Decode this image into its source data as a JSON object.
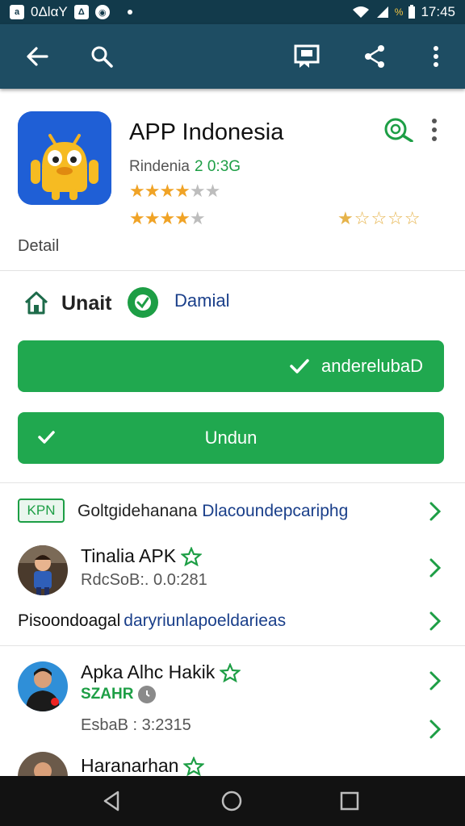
{
  "status_bar": {
    "left_text": "0ΔlαY",
    "time": "17:45",
    "battery_text": "%"
  },
  "app": {
    "title": "APP Indonesia",
    "developer": "Rindenia",
    "version": "2 0:3G",
    "detail_label": "Detail"
  },
  "status_row": {
    "left_label": "Unait",
    "right_label": "Damial"
  },
  "buttons": {
    "primary_label": "anderelubaD",
    "download_label": "Undun"
  },
  "list": {
    "kpn": {
      "badge": "KPN",
      "label": "Goltgidehanana",
      "link": "Dlacoundepcariphg"
    },
    "items": [
      {
        "title": "Tinalia APK",
        "subtitle": "RdcSoB:. 0.0:281"
      },
      {
        "title": "Apka Alhc Hakik",
        "tag": "SZAHR",
        "subtitle": "EsbaB : 3:2315"
      },
      {
        "title": "Haranarhan"
      }
    ],
    "pisoon": {
      "label": "Pisoondoagal",
      "link": "daryriunlapoeldarieas"
    }
  },
  "colors": {
    "toolbar": "#1e4d63",
    "status_bar": "#123a4b",
    "accent_green": "#20a84f",
    "link_blue": "#1a3f8a",
    "star_gold": "#f0a326"
  },
  "ratings": {
    "row1": 3.5,
    "row2": 4,
    "row2_right": 1.5,
    "max": 5
  }
}
